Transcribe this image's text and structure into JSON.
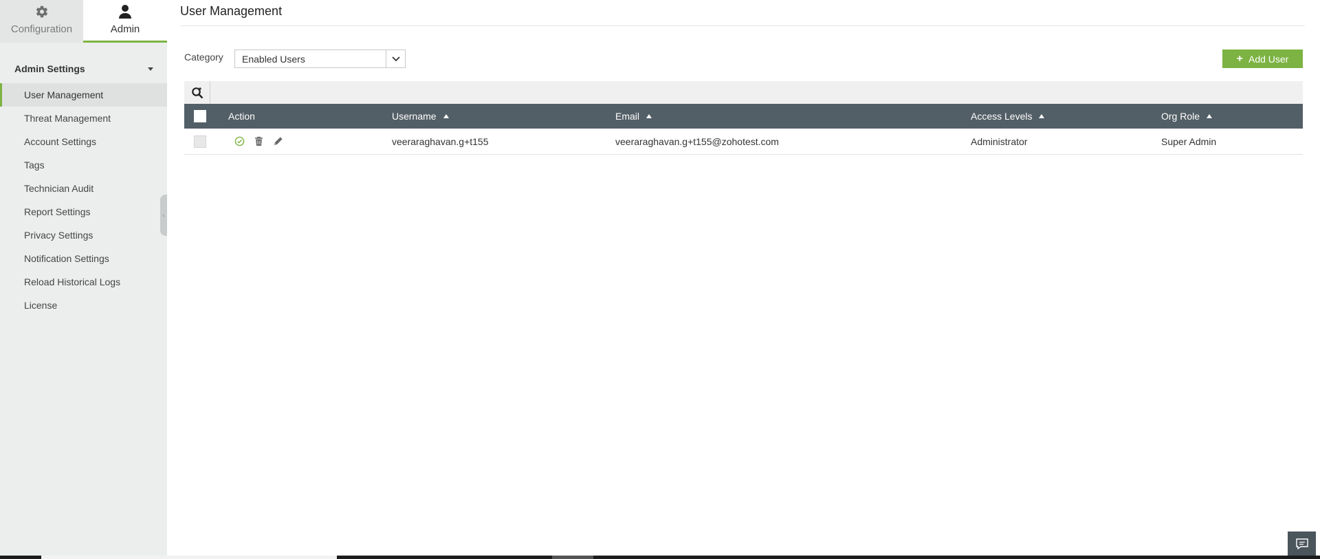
{
  "sidebar": {
    "tabs": [
      {
        "label": "Configuration",
        "icon": "gear-icon"
      },
      {
        "label": "Admin",
        "icon": "user-icon"
      }
    ],
    "section_title": "Admin Settings",
    "items": [
      {
        "label": "User Management"
      },
      {
        "label": "Threat Management"
      },
      {
        "label": "Account Settings"
      },
      {
        "label": "Tags"
      },
      {
        "label": "Technician Audit"
      },
      {
        "label": "Report Settings"
      },
      {
        "label": "Privacy Settings"
      },
      {
        "label": "Notification Settings"
      },
      {
        "label": "Reload Historical Logs"
      },
      {
        "label": "License"
      }
    ]
  },
  "main": {
    "title": "User Management",
    "category_label": "Category",
    "category_value": "Enabled Users",
    "add_user_label": "Add User"
  },
  "table": {
    "columns": [
      "Action",
      "Username",
      "Email",
      "Access Levels",
      "Org Role"
    ],
    "rows": [
      {
        "username": "veeraraghavan.g+t155",
        "email": "veeraraghavan.g+t155@zohotest.com",
        "access_level": "Administrator",
        "org_role": "Super Admin"
      }
    ]
  },
  "colors": {
    "accent": "#7cb342",
    "table_header": "#535f66",
    "sidebar_bg": "#eceeee"
  }
}
